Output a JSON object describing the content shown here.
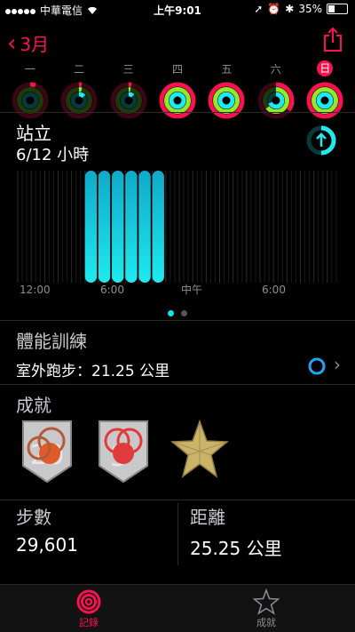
{
  "status": {
    "carrier": "中華電信",
    "time": "上午9:01",
    "battery": "35%"
  },
  "nav": {
    "back_label": "3月"
  },
  "week": {
    "days": [
      "一",
      "二",
      "三",
      "四",
      "五",
      "六",
      "日"
    ]
  },
  "stand": {
    "title": "站立",
    "value": "6/12 小時"
  },
  "chart_data": {
    "type": "bar",
    "x_tick_labels": [
      "12:00",
      "6:00",
      "中午",
      "6:00"
    ],
    "series": [
      {
        "values": [
          0,
          0,
          0,
          0,
          0,
          1,
          1,
          1,
          1,
          1,
          1,
          0,
          0,
          0,
          0,
          0,
          0,
          0,
          0,
          0,
          0,
          0,
          0,
          0
        ]
      }
    ],
    "ylim": [
      0,
      1
    ]
  },
  "workouts": {
    "label": "體能訓練",
    "item": "室外跑步：21.25 公里"
  },
  "achievements": {
    "label": "成就"
  },
  "stats": {
    "steps_label": "步數",
    "steps_value": "29,601",
    "distance_label": "距離",
    "distance_value": "25.25 公里"
  },
  "tabs": {
    "history": "記錄",
    "awards": "成就"
  },
  "colors": {
    "move": "#fa114f",
    "exercise": "#92e82a",
    "stand": "#1eeaef"
  }
}
